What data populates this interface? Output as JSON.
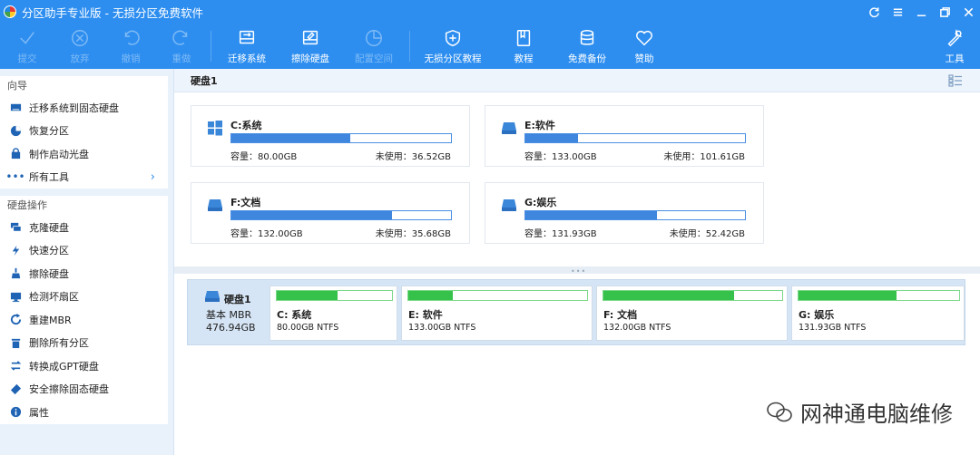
{
  "app": {
    "title": "分区助手专业版 - 无损分区免费软件"
  },
  "toolbar": {
    "commit": "提交",
    "discard": "放弃",
    "undo": "撤销",
    "redo": "重做",
    "migrate": "迁移系统",
    "wipe": "擦除硬盘",
    "allocate": "配置空间",
    "tutorial_lossless": "无损分区教程",
    "tutorial": "教程",
    "backup": "免费备份",
    "donate": "赞助",
    "tools": "工具"
  },
  "sidebar": {
    "wizard_header": "向导",
    "wizard_items": [
      {
        "label": "迁移系统到固态硬盘",
        "icon": "migrate-ssd-icon"
      },
      {
        "label": "恢复分区",
        "icon": "recover-partition-icon"
      },
      {
        "label": "制作启动光盘",
        "icon": "boot-disc-icon"
      },
      {
        "label": "所有工具",
        "icon": "more-icon"
      }
    ],
    "disk_ops_header": "硬盘操作",
    "disk_ops_items": [
      {
        "label": "克隆硬盘",
        "icon": "clone-disk-icon"
      },
      {
        "label": "快速分区",
        "icon": "lightning-icon"
      },
      {
        "label": "擦除硬盘",
        "icon": "wipe-icon"
      },
      {
        "label": "检测坏扇区",
        "icon": "bad-sector-icon"
      },
      {
        "label": "重建MBR",
        "icon": "rebuild-mbr-icon"
      },
      {
        "label": "删除所有分区",
        "icon": "trash-icon"
      },
      {
        "label": "转换成GPT硬盘",
        "icon": "convert-icon"
      },
      {
        "label": "安全擦除固态硬盘",
        "icon": "eraser-icon"
      },
      {
        "label": "属性",
        "icon": "info-icon"
      }
    ]
  },
  "main": {
    "disk_header": "硬盘1",
    "cap_label": "容量：",
    "free_label": "未使用：",
    "partitions": [
      {
        "name": "C:系统",
        "capacity": "80.00GB",
        "free": "36.52GB",
        "used_fraction": 0.54,
        "icon": "windows-icon"
      },
      {
        "name": "E:软件",
        "capacity": "133.00GB",
        "free": "101.61GB",
        "used_fraction": 0.24,
        "icon": "drive-icon"
      },
      {
        "name": "F:文档",
        "capacity": "132.00GB",
        "free": "35.68GB",
        "used_fraction": 0.73,
        "icon": "drive-icon"
      },
      {
        "name": "G:娱乐",
        "capacity": "131.93GB",
        "free": "52.42GB",
        "used_fraction": 0.6,
        "icon": "drive-icon"
      }
    ]
  },
  "diskmap": {
    "disk_name": "硬盘1",
    "disk_type": "基本 MBR",
    "disk_size": "476.94GB",
    "partitions": [
      {
        "name": "C: 系统",
        "info": "80.00GB NTFS",
        "used_fraction": 0.53
      },
      {
        "name": "E: 软件",
        "info": "133.00GB NTFS",
        "used_fraction": 0.25
      },
      {
        "name": "F: 文档",
        "info": "132.00GB NTFS",
        "used_fraction": 0.73
      },
      {
        "name": "G: 娱乐",
        "info": "131.93GB NTFS",
        "used_fraction": 0.61
      }
    ]
  },
  "watermark": {
    "text": "网神通电脑维修"
  },
  "colors": {
    "accent": "#2d8ef0",
    "bar_blue": "#3e86de",
    "bar_green": "#36c24a"
  }
}
